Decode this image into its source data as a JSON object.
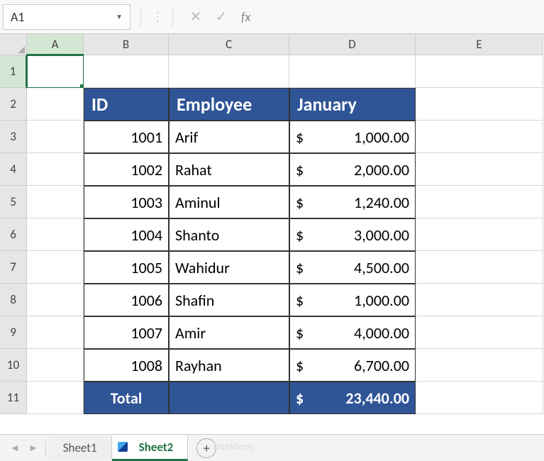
{
  "nameBox": {
    "value": "A1"
  },
  "formulaBar": {
    "fx": "fx",
    "value": ""
  },
  "columns": [
    "A",
    "B",
    "C",
    "D",
    "E"
  ],
  "rowNumbers": [
    1,
    2,
    3,
    4,
    5,
    6,
    7,
    8,
    9,
    10,
    11
  ],
  "table": {
    "headers": {
      "id": "ID",
      "employee": "Employee",
      "january": "January"
    },
    "rows": [
      {
        "id": "1001",
        "employee": "Arif",
        "amount": "1,000.00"
      },
      {
        "id": "1002",
        "employee": "Rahat",
        "amount": "2,000.00"
      },
      {
        "id": "1003",
        "employee": "Aminul",
        "amount": "1,240.00"
      },
      {
        "id": "1004",
        "employee": "Shanto",
        "amount": "3,000.00"
      },
      {
        "id": "1005",
        "employee": "Wahidur",
        "amount": "4,500.00"
      },
      {
        "id": "1006",
        "employee": "Shafin",
        "amount": "1,000.00"
      },
      {
        "id": "1007",
        "employee": "Amir",
        "amount": "4,000.00"
      },
      {
        "id": "1008",
        "employee": "Rayhan",
        "amount": "6,700.00"
      }
    ],
    "total": {
      "label": "Total",
      "amount": "23,440.00"
    },
    "currency": "$"
  },
  "sheetTabs": {
    "tab1": "Sheet1",
    "tab2": "Sheet2",
    "add": "+"
  },
  "watermark": "exceldemy"
}
